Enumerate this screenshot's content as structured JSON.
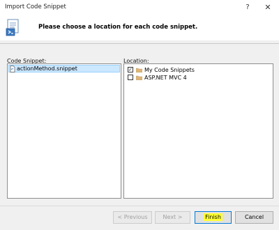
{
  "window": {
    "title": "Import Code Snippet",
    "help_glyph": "?",
    "close_glyph": "✕"
  },
  "header": {
    "message": "Please choose a location for each code snippet."
  },
  "snippets_panel": {
    "label": "Code Snippet:",
    "items": [
      {
        "name": "actionMethod.snippet",
        "selected": true
      }
    ]
  },
  "locations_panel": {
    "label": "Location:",
    "items": [
      {
        "name": "My Code Snippets",
        "checked": true,
        "check_glyph": "✓"
      },
      {
        "name": "ASP.NET MVC 4",
        "checked": false,
        "check_glyph": ""
      }
    ]
  },
  "buttons": {
    "previous": "< Previous",
    "next": "Next >",
    "finish": "Finish",
    "cancel": "Cancel"
  },
  "colors": {
    "selection": "#cce8ff",
    "finish_highlight": "#ffff33",
    "folder": "#dcb67a"
  }
}
